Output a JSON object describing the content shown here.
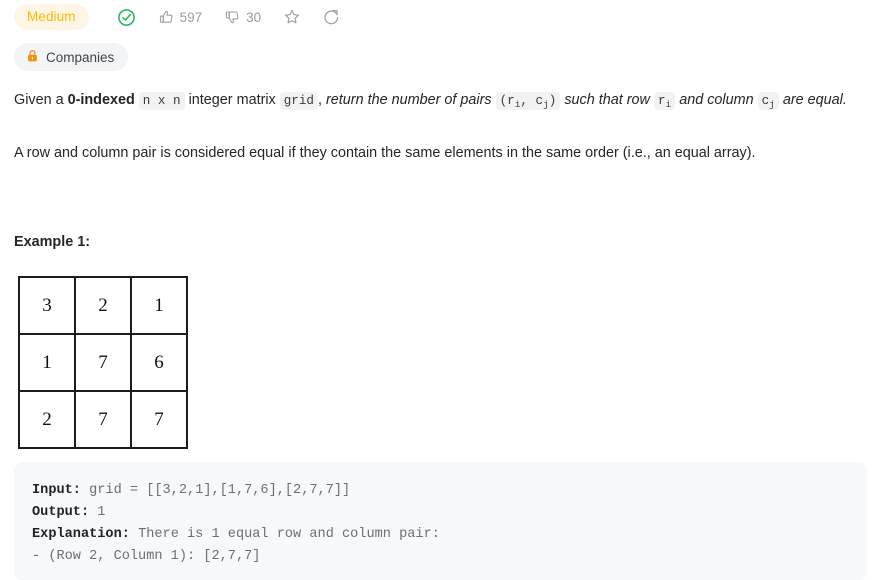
{
  "meta": {
    "difficulty": "Medium",
    "solved_icon": "circle-check-icon",
    "likes": "597",
    "dislikes": "30",
    "star_icon": "star-icon",
    "share_icon": "share-icon",
    "accent_difficulty_color": "#ffb800",
    "accent_difficulty_bg": "#fff5e4",
    "solved_color": "#2cbb5d"
  },
  "tags": {
    "lock_icon": "lock-icon",
    "companies_label": "Companies"
  },
  "description": {
    "p1": {
      "t1": "Given a ",
      "b1": "0-indexed",
      "c1": "n x n",
      "t2": " integer matrix ",
      "c2": "grid",
      "t3": ", ",
      "i1": "return the number of pairs ",
      "c3_open": "(r",
      "c3_sub1": "i",
      "c3_mid": ", c",
      "c3_sub2": "j",
      "c3_close": ")",
      "i2": " such that row ",
      "c4": "r",
      "c4_sub": "i",
      "i3": " and column ",
      "c5": "c",
      "c5_sub": "j",
      "i4": " are equal."
    },
    "p2": "A row and column pair is considered equal if they contain the same elements in the same order (i.e., an equal array)."
  },
  "example": {
    "title": "Example 1:",
    "matrix": [
      [
        "3",
        "2",
        "1"
      ],
      [
        "1",
        "7",
        "6"
      ],
      [
        "2",
        "7",
        "7"
      ]
    ],
    "code": {
      "input_label": "Input:",
      "input_value": " grid = [[3,2,1],[1,7,6],[2,7,7]]",
      "output_label": "Output:",
      "output_value": " 1",
      "explanation_label": "Explanation:",
      "explanation_value": " There is 1 equal row and column pair:",
      "explanation_line2": "- (Row 2, Column 1): [2,7,7]"
    }
  }
}
